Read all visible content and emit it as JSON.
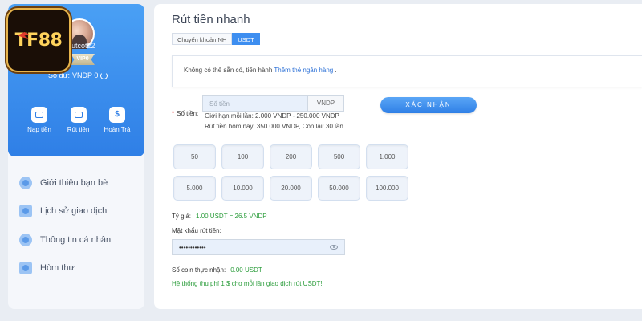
{
  "brand": {
    "logo_text": "TF88"
  },
  "profile": {
    "username": "ng Cutcot22",
    "vip": "VIP0",
    "balance_label": "Số dư:",
    "balance_value": "VNDP 0"
  },
  "actions": [
    {
      "label": "Nạp tiền",
      "icon": "wallet-icon"
    },
    {
      "label": "Rút tiền",
      "icon": "card-icon"
    },
    {
      "label": "Hoàn Trả",
      "icon": "dollar-icon"
    }
  ],
  "menu": [
    {
      "label": "Giới thiệu bạn bè",
      "icon": "friends-icon"
    },
    {
      "label": "Lịch sử giao dịch",
      "icon": "history-icon"
    },
    {
      "label": "Thông tin cá nhân",
      "icon": "user-icon"
    },
    {
      "label": "Hòm thư",
      "icon": "mail-icon"
    }
  ],
  "main": {
    "title": "Rút tiền nhanh",
    "tabs": [
      {
        "label": "Chuyển khoản NH",
        "active": false
      },
      {
        "label": "USDT",
        "active": true
      }
    ],
    "notice_text": "Không có thẻ sẵn có, tiến hành",
    "notice_link": "Thêm thẻ ngân hàng",
    "notice_suffix": ".",
    "amount_label": "Số tiền:",
    "amount_placeholder": "Số tiền",
    "amount_unit": "VNDP",
    "limit_line1": "Giới hạn mỗi lần: 2.000 VNDP - 250.000 VNDP",
    "limit_line2": "Rút tiền hôm nay: 350.000 VNDP, Còn lại: 30 lần",
    "confirm_label": "XÁC NHẬN",
    "quick_amounts": [
      "50",
      "100",
      "200",
      "500",
      "1.000",
      "5.000",
      "10.000",
      "20.000",
      "50.000",
      "100.000"
    ],
    "rate_label": "Tỷ giá:",
    "rate_value": "1.00 USDT = 26.5 VNDP",
    "password_label": "Mật khẩu rút tiền:",
    "password_value": "••••••••••••",
    "coin_label": "Số coin thực nhận:",
    "coin_value": "0.00 USDT",
    "fee_note": "Hệ thống thu phí 1 $ cho mỗi lần giao dịch rút USDT!"
  },
  "colors": {
    "accent": "#3d8ef0",
    "success": "#2a9c3a",
    "logo_gold": "#ffd35c"
  }
}
